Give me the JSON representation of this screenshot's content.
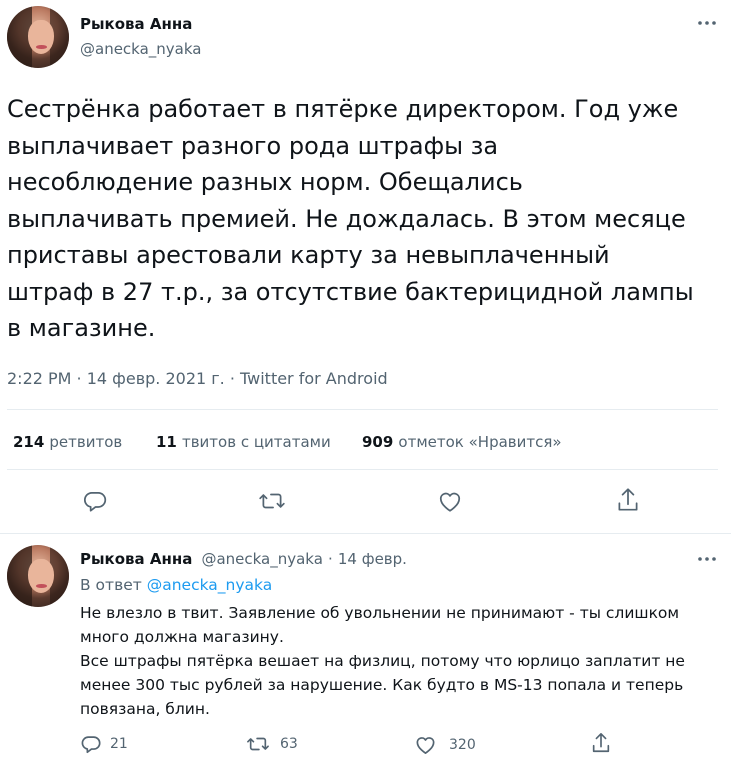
{
  "main_tweet": {
    "author_name": "Рыкова Анна",
    "author_handle": "@anecka_nyaka",
    "text_lines": [
      "Сестрёнка работает в пятёрке директором. Год уже",
      "выплачивает разного рода штрафы за",
      "несоблюдение разных норм. Обещались",
      "выплачивать премией. Не дождалась. В этом месяце",
      "приставы арестовали карту за невыплаченный",
      "штраф в 27 т.р., за отсутствие бактерицидной лампы",
      "в магазине."
    ],
    "timestamp": "2:22 PM · 14 февр. 2021 г. · Twitter for Android",
    "stats": {
      "retweets_count": "214",
      "retweets_label": "ретвитов",
      "quotes_count": "11",
      "quotes_label": "твитов с цитатами",
      "likes_count": "909",
      "likes_label": "отметок «Нравится»"
    },
    "actions": [
      "reply-icon",
      "retweet-icon",
      "like-icon",
      "share-icon"
    ]
  },
  "reply_tweet": {
    "author_name": "Рыкова Анна",
    "author_handle": "@anecka_nyaka",
    "dot": "·",
    "date": "14 февр.",
    "in_reply_prefix": "В ответ",
    "in_reply_handle": "@anecka_nyaka",
    "text_lines": [
      "Не влезло в твит. Заявление об увольнении не принимают - ты слишком",
      "много должна магазину.",
      "Все штрафы пятёрка вешает на физлиц, потому что юрлицо заплатит не",
      "менее 300 тыс рублей за нарушение. Как будто в MS-13 попала и теперь",
      "повязана, блин."
    ],
    "reply_count": "21",
    "retweet_count": "63",
    "like_count": "320"
  },
  "colors": {
    "text": "#0f1419",
    "secondary": "#536471",
    "link": "#1d9bf0",
    "divider": "#e6ecf0"
  }
}
